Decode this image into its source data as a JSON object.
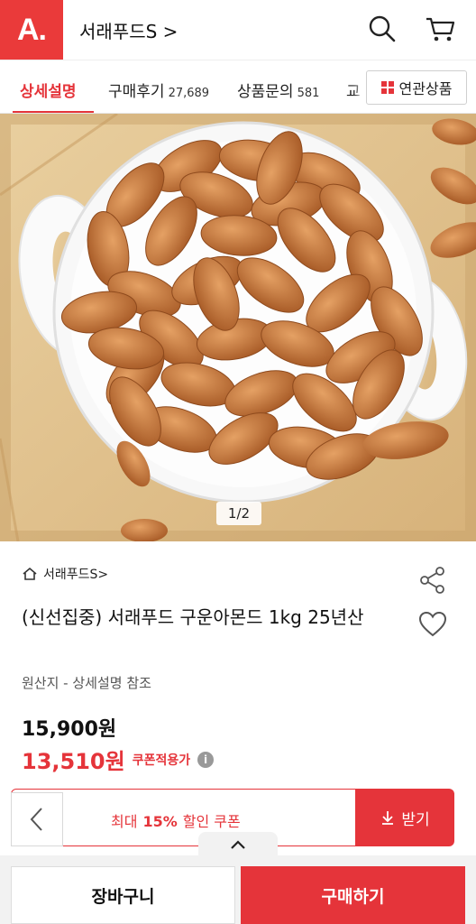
{
  "header": {
    "logo_text": "A.",
    "store_title": "서래푸드S >",
    "brand_color": "#ea3a3a",
    "icons": [
      "search-icon",
      "cart-icon"
    ]
  },
  "tabs": [
    {
      "label": "상세설명",
      "count": "",
      "active": true
    },
    {
      "label": "구매후기",
      "count": "27,689",
      "active": false
    },
    {
      "label": "상품문의",
      "count": "581",
      "active": false
    },
    {
      "label": "교",
      "count": "",
      "active": false
    }
  ],
  "related_button": {
    "label": "연관상품",
    "icon": "grid-icon"
  },
  "image": {
    "counter": "1/2"
  },
  "product": {
    "store_link": "서래푸드S>",
    "title": "(신선집중) 서래푸드 구운아몬드 1kg 25년산",
    "origin": "원산지 - 상세설명 참조",
    "original_price": "15,900원",
    "sale_price": "13,510원",
    "coupon_note": "쿠폰적용가",
    "info_icon": "i"
  },
  "coupon": {
    "prefix": "최대",
    "percent": "15%",
    "suffix": "할인 쿠폰",
    "receive_label": "받기"
  },
  "bottom": {
    "cart_label": "장바구니",
    "buy_label": "구매하기"
  },
  "colors": {
    "accent": "#e5343a"
  }
}
